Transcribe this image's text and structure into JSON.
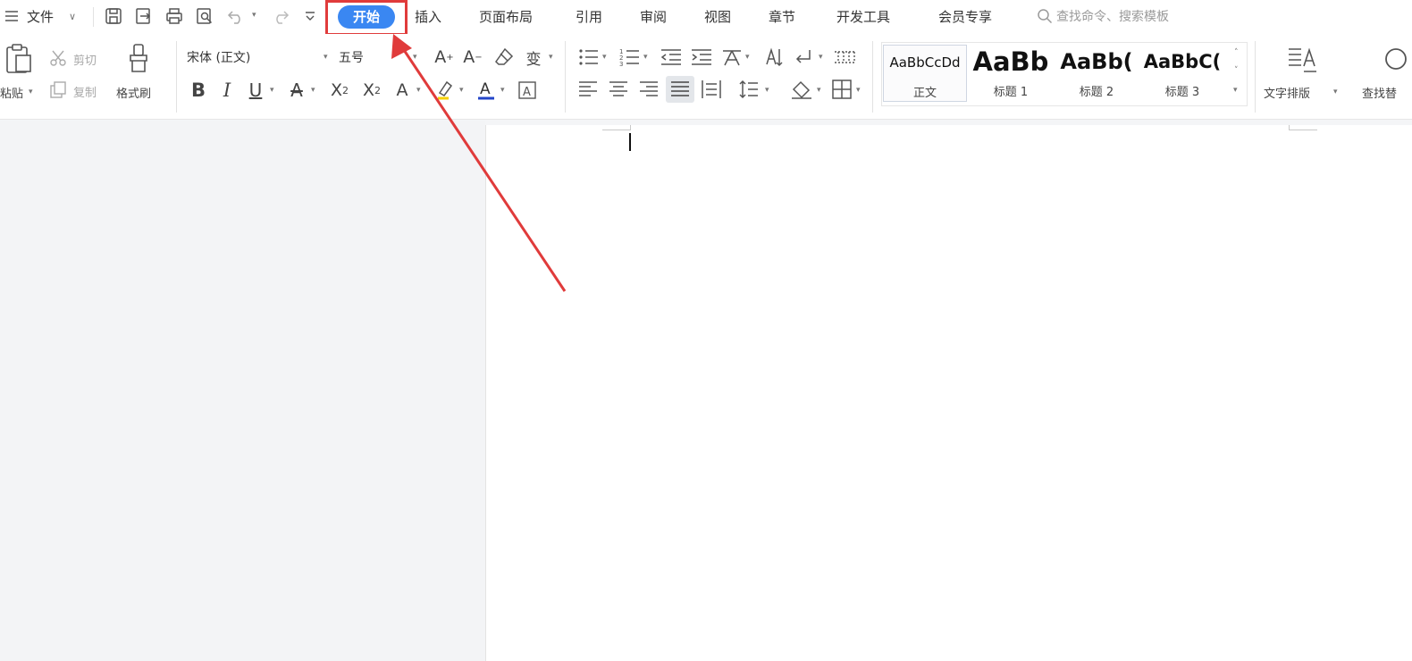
{
  "menu": {
    "file_label": "文件",
    "tabs": [
      "开始",
      "插入",
      "页面布局",
      "引用",
      "审阅",
      "视图",
      "章节",
      "开发工具",
      "会员专享"
    ],
    "active_tab": "开始",
    "search_placeholder": "查找命令、搜索模板"
  },
  "ribbon": {
    "paste_label": "粘贴",
    "cut_label": "剪切",
    "copy_label": "复制",
    "format_painter_label": "格式刷",
    "font_name": "宋体 (正文)",
    "font_size": "五号",
    "styles": [
      {
        "preview": "AaBbCcDd",
        "name": "正文"
      },
      {
        "preview": "AaBb",
        "name": "标题 1"
      },
      {
        "preview": "AaBb(",
        "name": "标题 2"
      },
      {
        "preview": "AaBbC(",
        "name": "标题 3"
      }
    ],
    "text_layout_label": "文字排版",
    "find_replace_label": "查找替"
  },
  "colors": {
    "active_tab_bg": "#3a87f2",
    "highlight_box": "#e03b3b",
    "arrow": "#e03b3b"
  }
}
